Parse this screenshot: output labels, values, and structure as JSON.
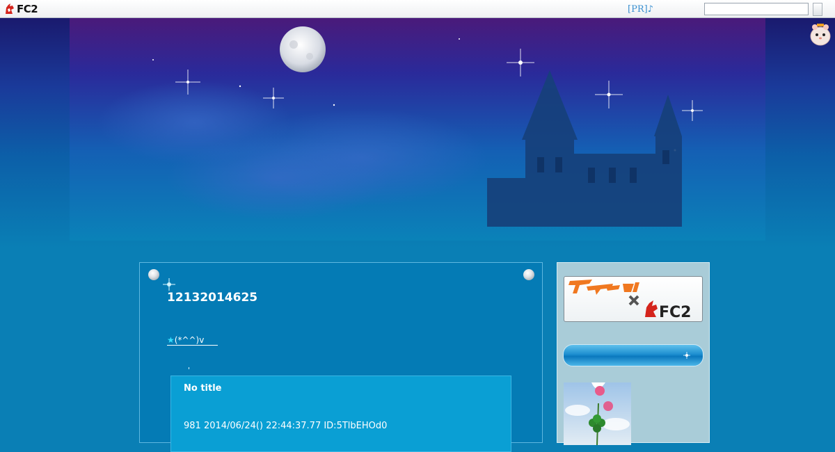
{
  "topbar": {
    "logo_text": "FC2",
    "pr_link": "[PR]♪",
    "search": {
      "value": "",
      "placeholder": ""
    },
    "search_button_label": ""
  },
  "entry": {
    "title": "12132014625",
    "link_star": "★",
    "link_text": "(*^^)v"
  },
  "comment": {
    "title": "No title",
    "meta": "981 2014/06/24() 22:44:37.77 ID:5TlbEHOd0"
  },
  "sidebar": {
    "banner_brand": "FC2"
  },
  "colors": {
    "accent_blue": "#0a7fb5",
    "link_star": "#35e0ff",
    "comment_bg": "#0a9fd4",
    "sidebar_bg": "#a9ccd8"
  }
}
